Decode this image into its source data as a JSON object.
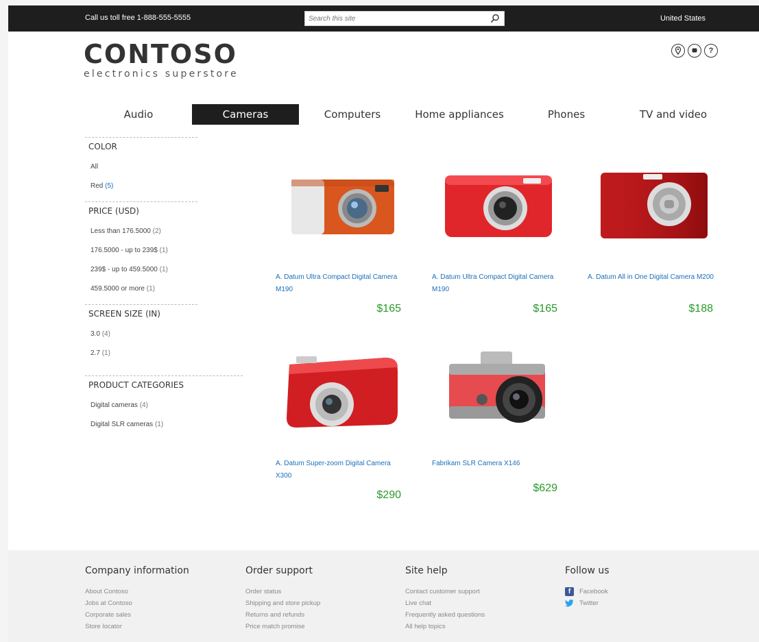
{
  "topbar": {
    "phone": "Call us toll free 1-888-555-5555",
    "search_placeholder": "Search this site",
    "country": "United States"
  },
  "logo": {
    "brand": "CONTOSO",
    "tagline": "electronics superstore"
  },
  "header_icons": [
    "location-icon",
    "chat-icon",
    "help-icon"
  ],
  "nav": {
    "tabs": [
      {
        "label": "Audio",
        "active": false
      },
      {
        "label": "Cameras",
        "active": true
      },
      {
        "label": "Computers",
        "active": false
      },
      {
        "label": "Home appliances",
        "active": false
      },
      {
        "label": "Phones",
        "active": false
      },
      {
        "label": "TV and video",
        "active": false
      }
    ]
  },
  "filters": {
    "color": {
      "title": "COLOR",
      "items": [
        {
          "label": "All",
          "count": ""
        },
        {
          "label": "Red",
          "count": "(5)"
        }
      ]
    },
    "price": {
      "title": "PRICE (USD)",
      "items": [
        {
          "label": "Less than 176.5000",
          "count": "(2)"
        },
        {
          "label": "176.5000 - up to 239$",
          "count": "(1)"
        },
        {
          "label": "239$ - up to 459.5000",
          "count": "(1)"
        },
        {
          "label": "459.5000 or more",
          "count": "(1)"
        }
      ]
    },
    "screen": {
      "title": "SCREEN SIZE (IN)",
      "items": [
        {
          "label": "3.0",
          "count": "(4)"
        },
        {
          "label": "2.7",
          "count": "(1)"
        }
      ]
    },
    "categories": {
      "title": "PRODUCT CATEGORIES",
      "items": [
        {
          "label": "Digital cameras",
          "count": "(4)"
        },
        {
          "label": "Digital SLR cameras",
          "count": "(1)"
        }
      ]
    }
  },
  "products": [
    {
      "name": "A. Datum Ultra Compact Digital Camera M190",
      "price": "$165"
    },
    {
      "name": "A. Datum Ultra Compact Digital Camera M190",
      "price": "$165"
    },
    {
      "name": "A. Datum All in One Digital Camera M200",
      "price": "$188"
    },
    {
      "name": "A. Datum Super-zoom Digital Camera X300",
      "price": "$290"
    },
    {
      "name": "Fabrikam SLR Camera X146",
      "price": "$629"
    }
  ],
  "footer": {
    "company": {
      "title": "Company information",
      "links": [
        "About Contoso",
        "Jobs at Contoso",
        "Corporate sales",
        "Store locator"
      ]
    },
    "order": {
      "title": "Order support",
      "links": [
        "Order status",
        "Shipping and store pickup",
        "Returns and refunds",
        "Price match promise"
      ]
    },
    "help": {
      "title": "Site help",
      "links": [
        "Contact customer support",
        "Live chat",
        "Frequently asked questions",
        "All help topics"
      ]
    },
    "follow": {
      "title": "Follow us",
      "links": [
        "Facebook",
        "Twitter"
      ]
    }
  }
}
